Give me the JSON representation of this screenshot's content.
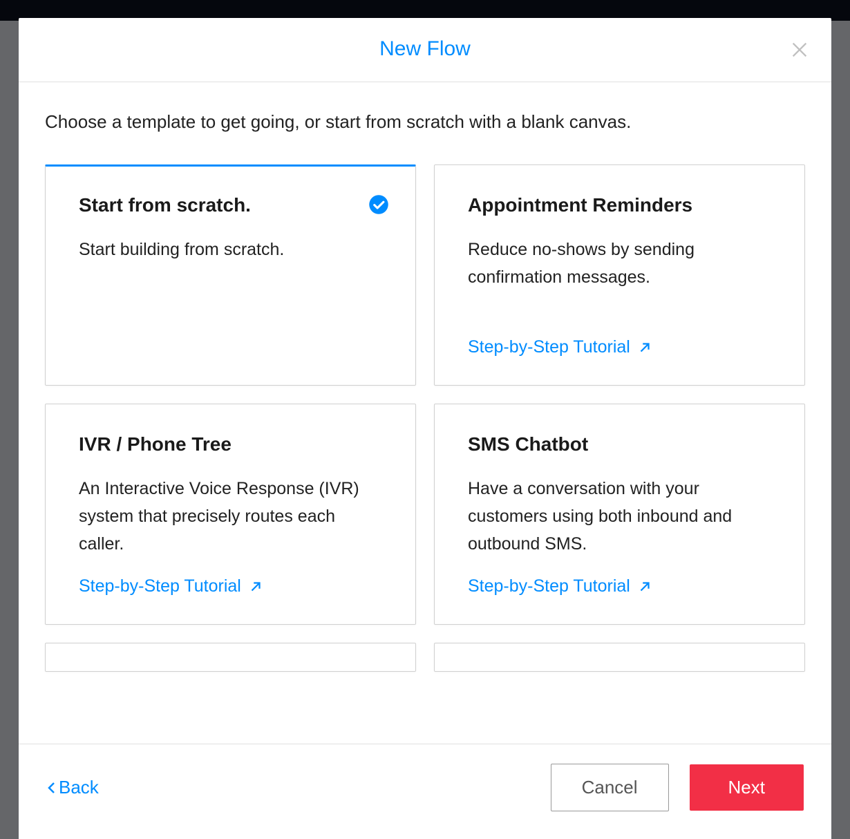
{
  "modal": {
    "title": "New Flow",
    "subtitle": "Choose a template to get going, or start from scratch with a blank canvas.",
    "cards": [
      {
        "title": "Start from scratch.",
        "desc": "Start building from scratch.",
        "selected": true,
        "link": null
      },
      {
        "title": "Appointment Reminders",
        "desc": "Reduce no-shows by sending confirmation messages.",
        "selected": false,
        "link": "Step-by-Step Tutorial"
      },
      {
        "title": "IVR / Phone Tree",
        "desc": "An Interactive Voice Response (IVR) system that precisely routes each caller.",
        "selected": false,
        "link": "Step-by-Step Tutorial"
      },
      {
        "title": "SMS Chatbot",
        "desc": "Have a conversation with your customers using both inbound and outbound SMS.",
        "selected": false,
        "link": "Step-by-Step Tutorial"
      }
    ],
    "footer": {
      "back": "Back",
      "cancel": "Cancel",
      "next": "Next"
    }
  }
}
